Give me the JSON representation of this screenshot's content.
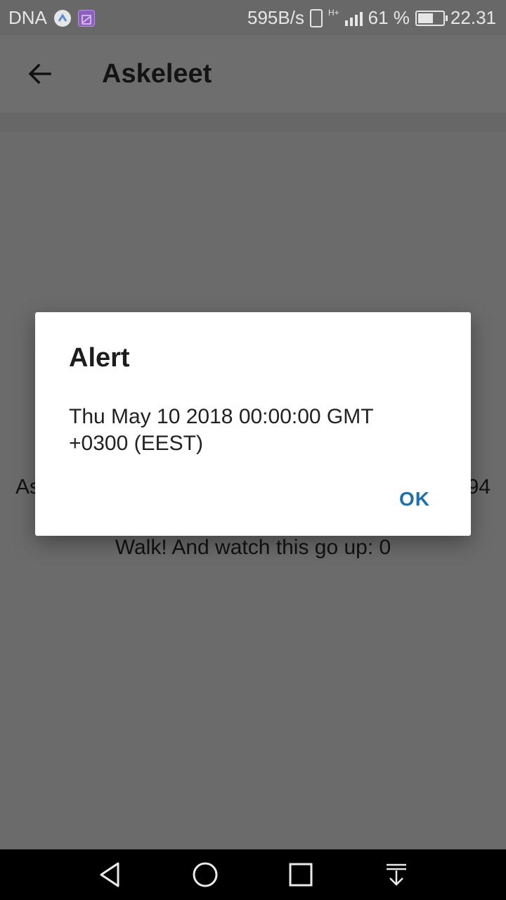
{
  "status_bar": {
    "carrier": "DNA",
    "net_speed": "595B/s",
    "network_type": "H+",
    "battery_percent": "61 %",
    "battery_level": 0.61,
    "time": "22.31"
  },
  "app_bar": {
    "title": "Askeleet"
  },
  "background": {
    "row1_left": "As",
    "row1_right": "94",
    "row2": "Walk! And watch this go up: 0"
  },
  "dialog": {
    "title": "Alert",
    "message": "Thu May 10 2018 00:00:00 GMT +0300 (EEST)",
    "ok_label": "OK"
  },
  "colors": {
    "accent": "#1f6fb0",
    "scrim": "#6b6b6b",
    "dialog_bg": "#ffffff"
  },
  "icons": {
    "back": "arrow-back-icon",
    "nav_back": "triangle-back-icon",
    "nav_home": "circle-home-icon",
    "nav_recents": "square-recents-icon",
    "nav_notifications": "pull-down-icon"
  }
}
